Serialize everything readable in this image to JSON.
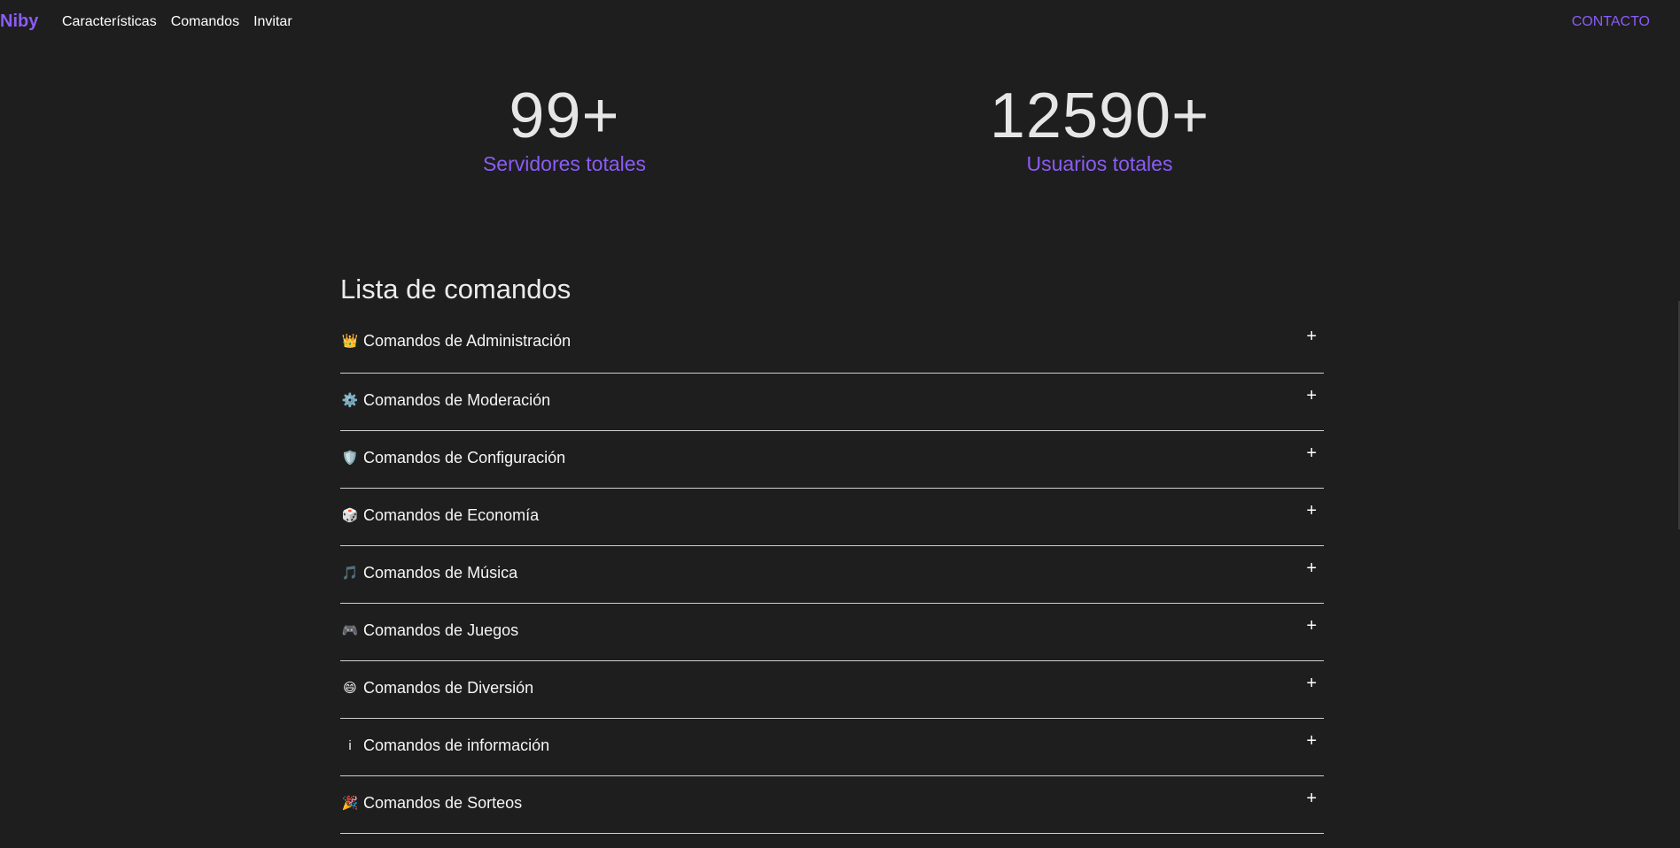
{
  "nav": {
    "brand": "Niby",
    "links": [
      "Características",
      "Comandos",
      "Invitar"
    ],
    "contact": "CONTACTO"
  },
  "stats": [
    {
      "number": "99+",
      "label": "Servidores totales"
    },
    {
      "number": "12590+",
      "label": "Usuarios totales"
    }
  ],
  "commands": {
    "title": "Lista de comandos",
    "items": [
      {
        "icon": "👑",
        "icon_name": "crown-icon",
        "label": "Comandos de Administración"
      },
      {
        "icon": "⚙️",
        "icon_name": "gear-icon",
        "label": "Comandos de Moderación"
      },
      {
        "icon": "🛡️",
        "icon_name": "shield-icon",
        "label": "Comandos de Configuración"
      },
      {
        "icon": "🎲",
        "icon_name": "dice-icon",
        "label": "Comandos de Economía"
      },
      {
        "icon": "🎵",
        "icon_name": "music-note-icon",
        "label": "Comandos de Música"
      },
      {
        "icon": "🎮",
        "icon_name": "gamepad-icon",
        "label": "Comandos de Juegos"
      },
      {
        "icon": "😄",
        "icon_name": "smile-icon",
        "label": "Comandos de Diversión"
      },
      {
        "icon": "i",
        "icon_name": "info-icon",
        "label": "Comandos de información"
      },
      {
        "icon": "🎉",
        "icon_name": "party-popper-icon",
        "label": "Comandos de Sorteos"
      }
    ],
    "expand_symbol": "+"
  },
  "colors": {
    "background": "#1e1e1f",
    "accent": "#8b5cf6",
    "text": "#f2f2f2"
  }
}
